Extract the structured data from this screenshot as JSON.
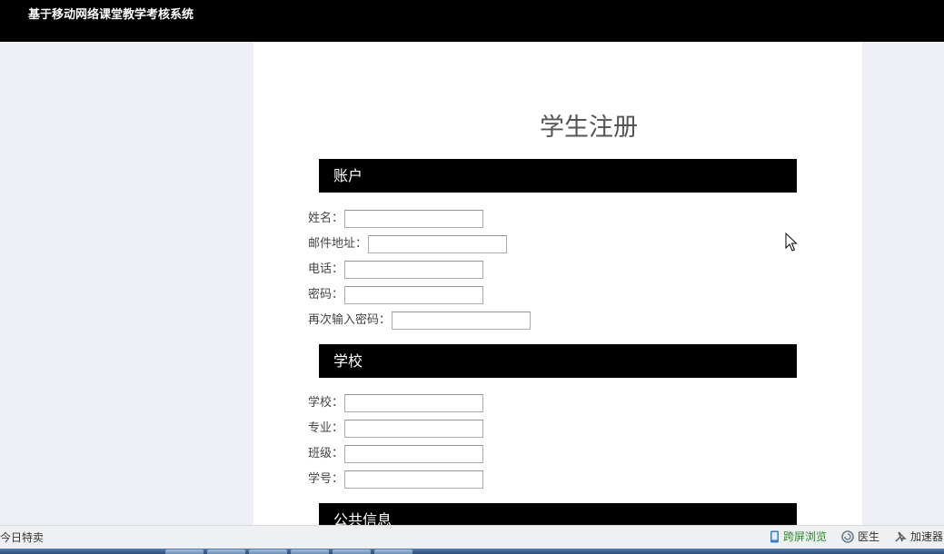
{
  "app": {
    "title": "基于移动网络课堂教学考核系统"
  },
  "form": {
    "title": "学生注册",
    "sections": [
      {
        "label": "账户",
        "fields": [
          {
            "label": "姓名：",
            "value": ""
          },
          {
            "label": "邮件地址：",
            "value": ""
          },
          {
            "label": "电话：",
            "value": ""
          },
          {
            "label": "密码：",
            "value": ""
          },
          {
            "label": "再次输入密码：",
            "value": ""
          }
        ]
      },
      {
        "label": "学校",
        "fields": [
          {
            "label": "学校：",
            "value": ""
          },
          {
            "label": "专业：",
            "value": ""
          },
          {
            "label": "班级：",
            "value": ""
          },
          {
            "label": "学号：",
            "value": ""
          }
        ]
      },
      {
        "label": "公共信息",
        "fields": []
      }
    ]
  },
  "statusbar": {
    "left_text": "今日特卖",
    "items": [
      {
        "label": "跨屏浏览",
        "icon": "phone-icon"
      },
      {
        "label": "医生",
        "icon": "doctor-icon"
      },
      {
        "label": "加速器",
        "icon": "accelerator-icon"
      }
    ]
  }
}
